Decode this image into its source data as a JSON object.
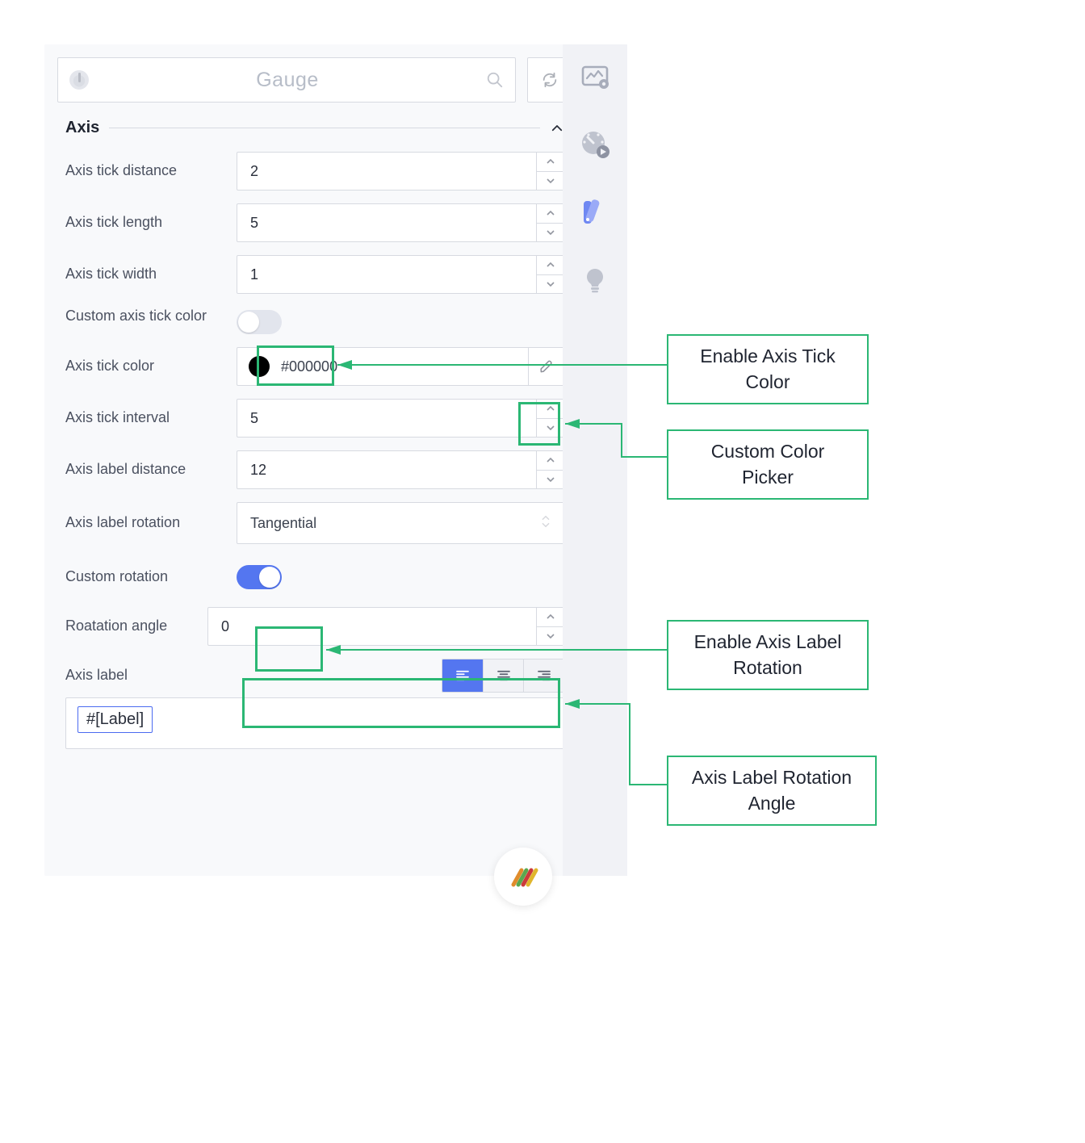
{
  "header": {
    "widget_type": "Gauge"
  },
  "section": {
    "title": "Axis"
  },
  "fields": {
    "tick_distance": {
      "label": "Axis tick distance",
      "value": "2"
    },
    "tick_length": {
      "label": "Axis tick length",
      "value": "5"
    },
    "tick_width": {
      "label": "Axis tick width",
      "value": "1"
    },
    "custom_tick_color": {
      "label": "Custom axis tick color",
      "on": false
    },
    "tick_color": {
      "label": "Axis tick color",
      "hex": "#000000"
    },
    "tick_interval": {
      "label": "Axis tick interval",
      "value": "5"
    },
    "label_distance": {
      "label": "Axis label distance",
      "value": "12"
    },
    "label_rotation": {
      "label": "Axis label rotation",
      "value": "Tangential"
    },
    "custom_rotation": {
      "label": "Custom rotation",
      "on": true
    },
    "rotation_angle": {
      "label": "Roatation angle",
      "value": "0"
    },
    "axis_label": {
      "label": "Axis label",
      "chip": "#[Label]"
    }
  },
  "annotations": {
    "a": "Enable Axis Tick Color",
    "b": "Custom Color Picker",
    "c": "Enable Axis Label Rotation",
    "d": "Axis Label Rotation Angle"
  }
}
